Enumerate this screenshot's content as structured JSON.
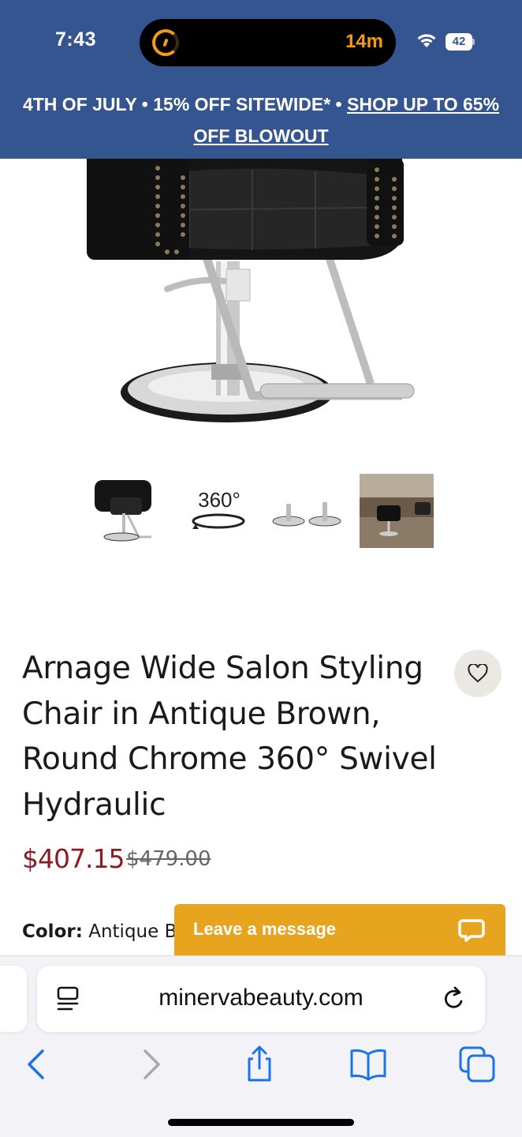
{
  "status_bar": {
    "time": "7:43",
    "activity_timer": "14m",
    "battery": "42"
  },
  "promo": {
    "text": "4TH OF JULY • 15% OFF SITEWIDE* • ",
    "link": "SHOP UP TO 65% OFF BLOWOUT"
  },
  "gallery": {
    "thumb_360_label": "360°"
  },
  "product": {
    "title": "Arnage Wide Salon Styling Chair in Antique Brown, Round Chrome 360° Swivel Hydraulic",
    "price": "$407.15",
    "old_price": "$479.00",
    "color_label": "Color:",
    "color_value": "Antique B"
  },
  "chat": {
    "label": "Leave a message"
  },
  "browser": {
    "url": "minervabeauty.com"
  },
  "colors": {
    "brand_blue": "#34558f",
    "price_red": "#8c1c24",
    "chat_orange": "#e6a41f",
    "ios_blue": "#1a73e8"
  }
}
